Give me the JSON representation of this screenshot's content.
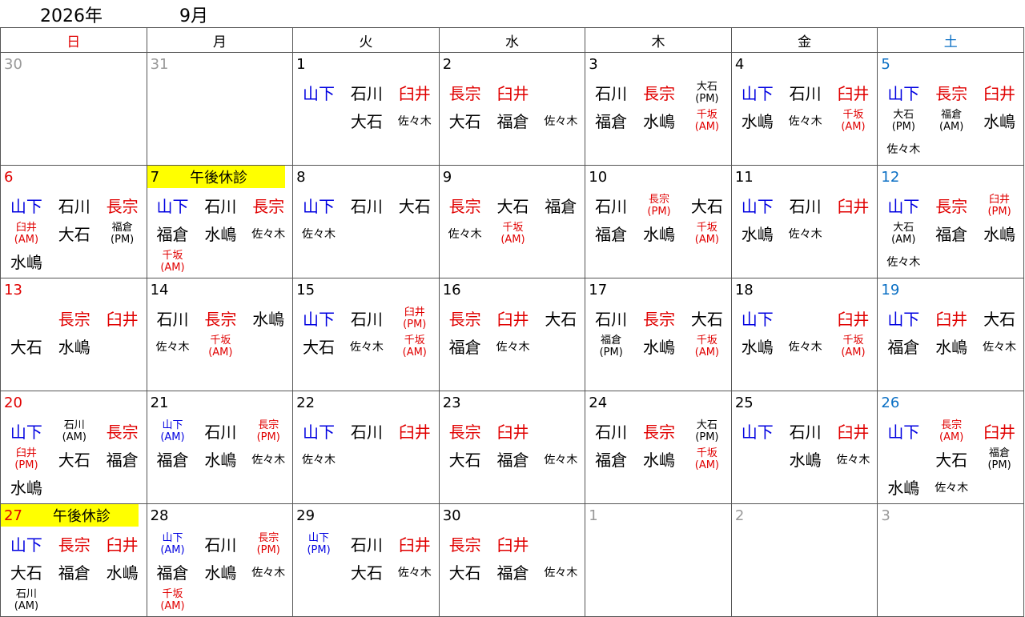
{
  "year": "2026年",
  "month": "9月",
  "weekdays": [
    "日",
    "月",
    "火",
    "水",
    "木",
    "金",
    "土"
  ],
  "weeks": [
    [
      {
        "d": "30",
        "t": "other",
        "s": []
      },
      {
        "d": "31",
        "t": "other",
        "s": []
      },
      {
        "d": "1",
        "s": [
          [
            "山下",
            "blue"
          ],
          [
            "石川",
            "blk"
          ],
          [
            "臼井",
            "red"
          ],
          null,
          [
            "大石",
            "blk"
          ],
          [
            "佐々木",
            "blk"
          ]
        ]
      },
      {
        "d": "2",
        "s": [
          [
            "長宗",
            "red"
          ],
          [
            "臼井",
            "red"
          ],
          null,
          [
            "大石",
            "blk"
          ],
          [
            "福倉",
            "blk"
          ],
          [
            "佐々木",
            "blk"
          ]
        ]
      },
      {
        "d": "3",
        "s": [
          [
            "石川",
            "blk"
          ],
          [
            "長宗",
            "red"
          ],
          [
            "大石\n(PM)",
            "blk"
          ],
          [
            "福倉",
            "blk"
          ],
          [
            "水嶋",
            "blk"
          ],
          [
            "千坂\n(AM)",
            "red"
          ]
        ]
      },
      {
        "d": "4",
        "s": [
          [
            "山下",
            "blue"
          ],
          [
            "石川",
            "blk"
          ],
          [
            "臼井",
            "red"
          ],
          [
            "水嶋",
            "blk"
          ],
          [
            "佐々木",
            "blk"
          ],
          [
            "千坂\n(AM)",
            "red"
          ]
        ]
      },
      {
        "d": "5",
        "t": "sat",
        "s": [
          [
            "山下",
            "blue"
          ],
          [
            "長宗",
            "red"
          ],
          [
            "臼井",
            "red"
          ],
          [
            "大石\n(PM)",
            "blk"
          ],
          [
            "福倉\n(AM)",
            "blk"
          ],
          [
            "水嶋",
            "blk"
          ],
          [
            "佐々木",
            "blk"
          ]
        ]
      }
    ],
    [
      {
        "d": "6",
        "t": "sun",
        "s": [
          [
            "山下",
            "blue"
          ],
          [
            "石川",
            "blk"
          ],
          [
            "長宗",
            "red"
          ],
          [
            "臼井\n(AM)",
            "red"
          ],
          [
            "大石",
            "blk"
          ],
          [
            "福倉\n(PM)",
            "blk"
          ],
          [
            "水嶋",
            "blk"
          ]
        ]
      },
      {
        "d": "7",
        "note": "午後休診",
        "s": [
          [
            "山下",
            "blue"
          ],
          [
            "石川",
            "blk"
          ],
          [
            "長宗",
            "red"
          ],
          [
            "福倉",
            "blk"
          ],
          [
            "水嶋",
            "blk"
          ],
          [
            "佐々木",
            "blk"
          ],
          [
            "千坂\n(AM)",
            "red"
          ]
        ]
      },
      {
        "d": "8",
        "s": [
          [
            "山下",
            "blue"
          ],
          [
            "石川",
            "blk"
          ],
          [
            "大石",
            "blk"
          ],
          [
            "佐々木",
            "blk"
          ]
        ]
      },
      {
        "d": "9",
        "s": [
          [
            "長宗",
            "red"
          ],
          [
            "大石",
            "blk"
          ],
          [
            "福倉",
            "blk"
          ],
          [
            "佐々木",
            "blk"
          ],
          [
            "千坂\n(AM)",
            "red"
          ]
        ]
      },
      {
        "d": "10",
        "s": [
          [
            "石川",
            "blk"
          ],
          [
            "長宗\n(PM)",
            "red"
          ],
          [
            "大石",
            "blk"
          ],
          [
            "福倉",
            "blk"
          ],
          [
            "水嶋",
            "blk"
          ],
          [
            "千坂\n(AM)",
            "red"
          ]
        ]
      },
      {
        "d": "11",
        "s": [
          [
            "山下",
            "blue"
          ],
          [
            "石川",
            "blk"
          ],
          [
            "臼井",
            "red"
          ],
          [
            "水嶋",
            "blk"
          ],
          [
            "佐々木",
            "blk"
          ]
        ]
      },
      {
        "d": "12",
        "t": "sat",
        "s": [
          [
            "山下",
            "blue"
          ],
          [
            "長宗",
            "red"
          ],
          [
            "臼井\n(PM)",
            "red"
          ],
          [
            "大石\n(AM)",
            "blk"
          ],
          [
            "福倉",
            "blk"
          ],
          [
            "水嶋",
            "blk"
          ],
          [
            "佐々木",
            "blk"
          ]
        ]
      }
    ],
    [
      {
        "d": "13",
        "t": "sun",
        "s": [
          null,
          [
            "長宗",
            "red"
          ],
          [
            "臼井",
            "red"
          ],
          [
            "大石",
            "blk"
          ],
          [
            "水嶋",
            "blk"
          ]
        ]
      },
      {
        "d": "14",
        "s": [
          [
            "石川",
            "blk"
          ],
          [
            "長宗",
            "red"
          ],
          [
            "水嶋",
            "blk"
          ],
          [
            "佐々木",
            "blk"
          ],
          [
            "千坂\n(AM)",
            "red"
          ]
        ]
      },
      {
        "d": "15",
        "s": [
          [
            "山下",
            "blue"
          ],
          [
            "石川",
            "blk"
          ],
          [
            "臼井\n(PM)",
            "red"
          ],
          [
            "大石",
            "blk"
          ],
          [
            "佐々木",
            "blk"
          ],
          [
            "千坂\n(AM)",
            "red"
          ]
        ]
      },
      {
        "d": "16",
        "s": [
          [
            "長宗",
            "red"
          ],
          [
            "臼井",
            "red"
          ],
          [
            "大石",
            "blk"
          ],
          [
            "福倉",
            "blk"
          ],
          [
            "佐々木",
            "blk"
          ]
        ]
      },
      {
        "d": "17",
        "s": [
          [
            "石川",
            "blk"
          ],
          [
            "長宗",
            "red"
          ],
          [
            "大石",
            "blk"
          ],
          [
            "福倉\n(PM)",
            "blk"
          ],
          [
            "水嶋",
            "blk"
          ],
          [
            "千坂\n(AM)",
            "red"
          ]
        ]
      },
      {
        "d": "18",
        "s": [
          [
            "山下",
            "blue"
          ],
          null,
          [
            "臼井",
            "red"
          ],
          [
            "水嶋",
            "blk"
          ],
          [
            "佐々木",
            "blk"
          ],
          [
            "千坂\n(AM)",
            "red"
          ]
        ]
      },
      {
        "d": "19",
        "t": "sat",
        "s": [
          [
            "山下",
            "blue"
          ],
          [
            "臼井",
            "red"
          ],
          [
            "大石",
            "blk"
          ],
          [
            "福倉",
            "blk"
          ],
          [
            "水嶋",
            "blk"
          ],
          [
            "佐々木",
            "blk"
          ]
        ]
      }
    ],
    [
      {
        "d": "20",
        "t": "sun",
        "s": [
          [
            "山下",
            "blue"
          ],
          [
            "石川\n(AM)",
            "blk"
          ],
          [
            "長宗",
            "red"
          ],
          [
            "臼井\n(PM)",
            "red"
          ],
          [
            "大石",
            "blk"
          ],
          [
            "福倉",
            "blk"
          ],
          [
            "水嶋",
            "blk"
          ]
        ]
      },
      {
        "d": "21",
        "s": [
          [
            "山下\n(AM)",
            "blue"
          ],
          [
            "石川",
            "blk"
          ],
          [
            "長宗\n(PM)",
            "red"
          ],
          [
            "福倉",
            "blk"
          ],
          [
            "水嶋",
            "blk"
          ],
          [
            "佐々木",
            "blk"
          ]
        ]
      },
      {
        "d": "22",
        "s": [
          [
            "山下",
            "blue"
          ],
          [
            "石川",
            "blk"
          ],
          [
            "臼井",
            "red"
          ],
          [
            "佐々木",
            "blk"
          ]
        ]
      },
      {
        "d": "23",
        "s": [
          [
            "長宗",
            "red"
          ],
          [
            "臼井",
            "red"
          ],
          null,
          [
            "大石",
            "blk"
          ],
          [
            "福倉",
            "blk"
          ],
          [
            "佐々木",
            "blk"
          ]
        ]
      },
      {
        "d": "24",
        "s": [
          [
            "石川",
            "blk"
          ],
          [
            "長宗",
            "red"
          ],
          [
            "大石\n(PM)",
            "blk"
          ],
          [
            "福倉",
            "blk"
          ],
          [
            "水嶋",
            "blk"
          ],
          [
            "千坂\n(AM)",
            "red"
          ]
        ]
      },
      {
        "d": "25",
        "s": [
          [
            "山下",
            "blue"
          ],
          [
            "石川",
            "blk"
          ],
          [
            "臼井",
            "red"
          ],
          null,
          [
            "水嶋",
            "blk"
          ],
          [
            "佐々木",
            "blk"
          ]
        ]
      },
      {
        "d": "26",
        "t": "sat",
        "s": [
          [
            "山下",
            "blue"
          ],
          [
            "長宗\n(AM)",
            "red"
          ],
          [
            "臼井",
            "red"
          ],
          null,
          [
            "大石",
            "blk"
          ],
          [
            "福倉\n(PM)",
            "blk"
          ],
          [
            "水嶋",
            "blk"
          ],
          [
            "佐々木",
            "blk"
          ]
        ]
      }
    ],
    [
      {
        "d": "27",
        "t": "sun",
        "note": "午後休診",
        "s": [
          [
            "山下",
            "blue"
          ],
          [
            "長宗",
            "red"
          ],
          [
            "臼井",
            "red"
          ],
          [
            "大石",
            "blk"
          ],
          [
            "福倉",
            "blk"
          ],
          [
            "水嶋",
            "blk"
          ],
          [
            "石川\n(AM)",
            "blk"
          ]
        ]
      },
      {
        "d": "28",
        "s": [
          [
            "山下\n(AM)",
            "blue"
          ],
          [
            "石川",
            "blk"
          ],
          [
            "長宗\n(PM)",
            "red"
          ],
          [
            "福倉",
            "blk"
          ],
          [
            "水嶋",
            "blk"
          ],
          [
            "佐々木",
            "blk"
          ],
          [
            "千坂\n(AM)",
            "red"
          ]
        ]
      },
      {
        "d": "29",
        "s": [
          [
            "山下\n(PM)",
            "blue"
          ],
          [
            "石川",
            "blk"
          ],
          [
            "臼井",
            "red"
          ],
          null,
          [
            "大石",
            "blk"
          ],
          [
            "佐々木",
            "blk"
          ]
        ]
      },
      {
        "d": "30",
        "s": [
          [
            "長宗",
            "red"
          ],
          [
            "臼井",
            "red"
          ],
          null,
          [
            "大石",
            "blk"
          ],
          [
            "福倉",
            "blk"
          ],
          [
            "佐々木",
            "blk"
          ]
        ]
      },
      {
        "d": "1",
        "t": "other",
        "s": []
      },
      {
        "d": "2",
        "t": "other",
        "s": []
      },
      {
        "d": "3",
        "t": "other",
        "s": []
      }
    ]
  ]
}
